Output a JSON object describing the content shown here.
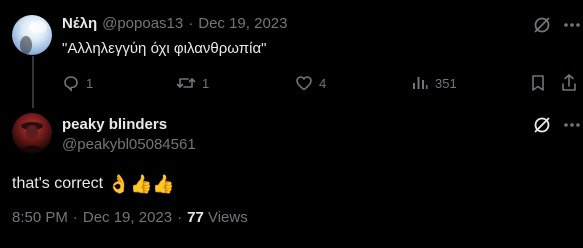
{
  "parent_tweet": {
    "display_name": "Νέλη",
    "handle": "@popoas13",
    "separator": "·",
    "date": "Dec 19, 2023",
    "text": "\"Αλληλεγγύη όχι φιλανθρωπία\"",
    "actions": {
      "replies": "1",
      "retweets": "1",
      "likes": "4",
      "views": "351"
    }
  },
  "main_tweet": {
    "display_name": "peaky blinders",
    "handle": "@peakybl05084561",
    "text": "that's correct",
    "emojis": [
      "👌",
      "👍",
      "👍"
    ],
    "time": "8:50 PM",
    "separator": "·",
    "date": "Dec 19, 2023",
    "separator2": "·",
    "views_count": "77",
    "views_label": "Views"
  },
  "colors": {
    "background": "#000000",
    "primary_text": "#e7e9ea",
    "secondary_text": "#71767b",
    "thread_line": "#333639"
  }
}
